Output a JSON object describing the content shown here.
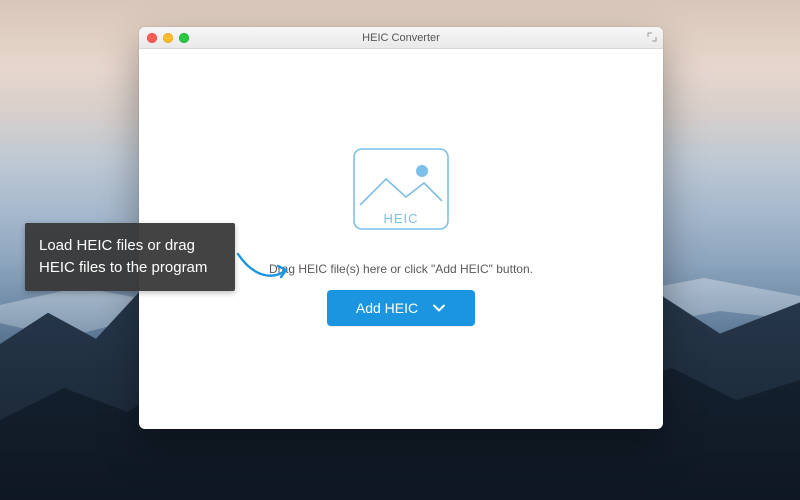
{
  "window": {
    "title": "HEIC Converter"
  },
  "dropzone": {
    "icon_label": "HEIC",
    "instruction": "Drag HEIC file(s) here or click \"Add HEIC\" button."
  },
  "button": {
    "label": "Add HEIC"
  },
  "tooltip": {
    "text": "Load HEIC files or drag HEIC files to the program"
  },
  "colors": {
    "accent": "#1c95e0",
    "icon_stroke": "#7cbfe8"
  }
}
